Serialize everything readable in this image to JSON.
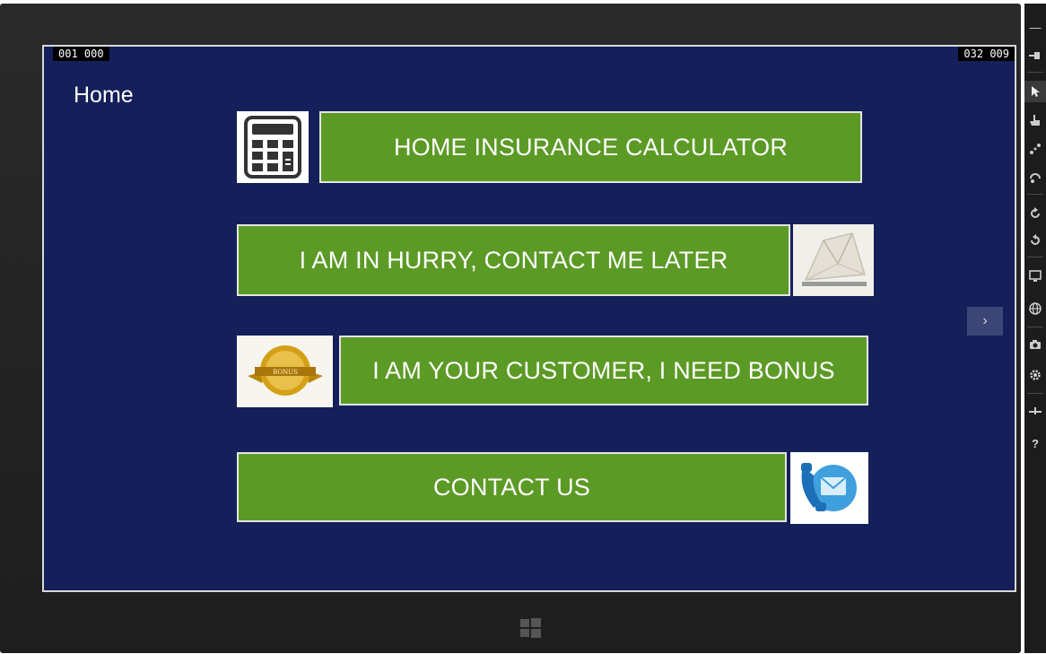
{
  "screen": {
    "counter_left": "001  000",
    "counter_right": "032  009",
    "page_title": "Home",
    "side_arrow": "›"
  },
  "buttons": {
    "calculator": "HOME INSURANCE CALCULATOR",
    "hurry": "I AM IN HURRY, CONTACT ME LATER",
    "customer": "I AM YOUR CUSTOMER, I NEED BONUS",
    "contact": "CONTACT US"
  },
  "icons": {
    "calculator": "calculator-icon",
    "envelope": "envelope-icon",
    "bonus_badge": "bonus-badge-icon",
    "phone": "phone-email-icon"
  },
  "toolbar": {
    "minimize": "—",
    "help": "?"
  },
  "colors": {
    "screen_bg": "#15205a",
    "button_green": "#5c9a26",
    "device_frame": "#1e1e1e"
  }
}
